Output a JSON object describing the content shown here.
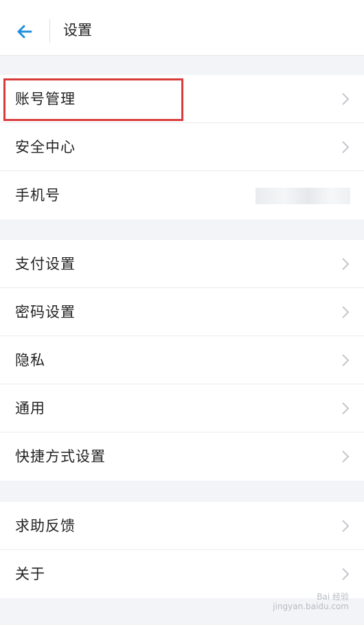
{
  "header": {
    "title": "设置"
  },
  "groups": [
    {
      "items": [
        {
          "label": "账号管理"
        },
        {
          "label": "安全中心"
        },
        {
          "label": "手机号"
        }
      ]
    },
    {
      "items": [
        {
          "label": "支付设置"
        },
        {
          "label": "密码设置"
        },
        {
          "label": "隐私"
        },
        {
          "label": "通用"
        },
        {
          "label": "快捷方式设置"
        }
      ]
    },
    {
      "items": [
        {
          "label": "求助反馈"
        },
        {
          "label": "关于"
        }
      ]
    }
  ],
  "colors": {
    "accent": "#1e8fdc",
    "highlight": "#d93a3a",
    "background": "#f2f4f7"
  },
  "watermark": {
    "line1": "Bai 经验",
    "line2": "jingyan.baidu.com"
  }
}
